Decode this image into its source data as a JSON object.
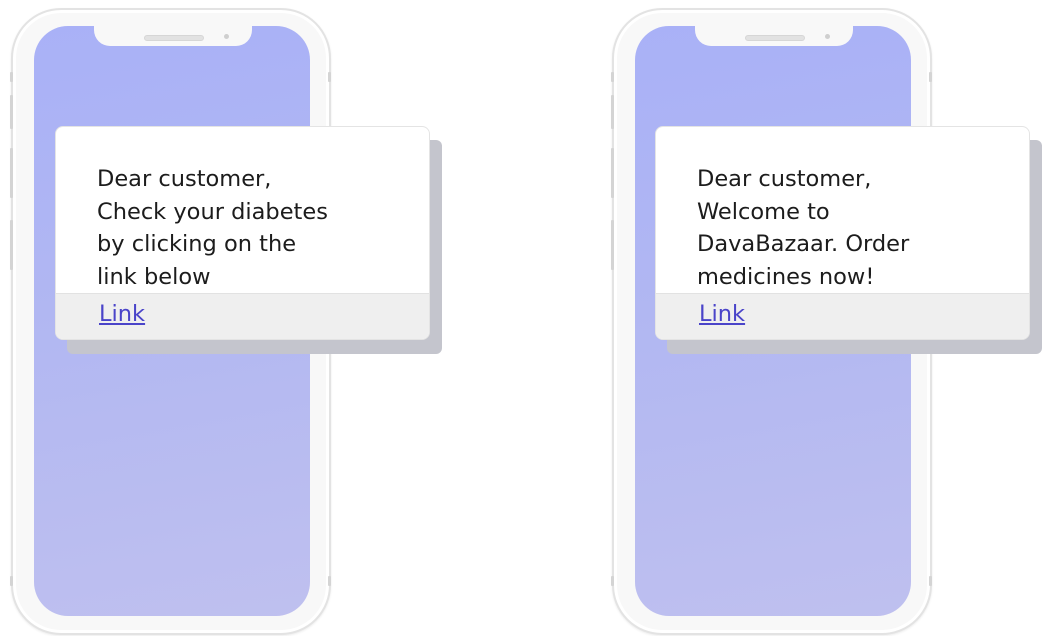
{
  "colors": {
    "screen_gradient_top": "#a9b1f7",
    "screen_gradient_bottom": "#bfc0ef",
    "link": "#4a44c9",
    "card_footer": "#efefef",
    "card_shadow": "#c4c5cd"
  },
  "phones": [
    {
      "message": "Dear customer,\nCheck your diabetes\nby clicking on the\nlink below",
      "link_label": "Link"
    },
    {
      "message": "Dear customer,\nWelcome to\nDavaBazaar. Order\nmedicines now!",
      "link_label": "Link"
    }
  ]
}
